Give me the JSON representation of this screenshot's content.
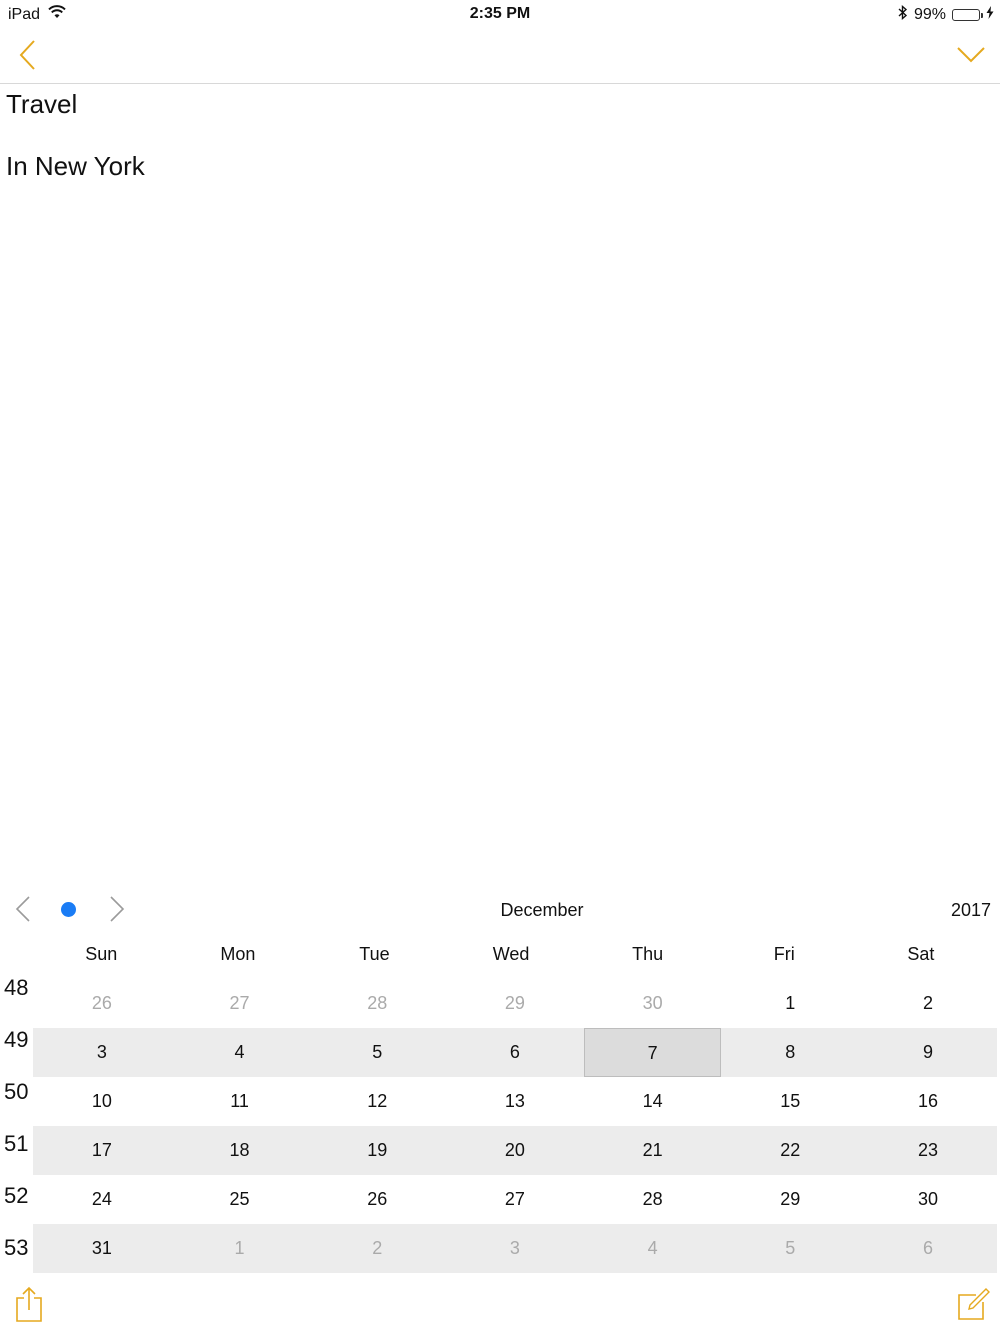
{
  "status_bar": {
    "device": "iPad",
    "time": "2:35 PM",
    "battery_percent": "99%",
    "battery_level": 0.99,
    "battery_color": "#4cd964"
  },
  "colors": {
    "accent": "#e5a91f",
    "today_dot": "#1a7cf5",
    "muted_text": "#aaaaaa"
  },
  "nav": {
    "back_icon": "chevron-left-icon",
    "done_icon": "chevron-down-icon"
  },
  "note": {
    "title": "Travel",
    "body": "In New York"
  },
  "calendar": {
    "month": "December",
    "year": "2017",
    "weekdays": [
      "Sun",
      "Mon",
      "Tue",
      "Wed",
      "Thu",
      "Fri",
      "Sat"
    ],
    "week_numbers": [
      "48",
      "49",
      "50",
      "51",
      "52",
      "53"
    ],
    "selected_day": "7",
    "weeks": [
      [
        {
          "d": "26",
          "m": true
        },
        {
          "d": "27",
          "m": true
        },
        {
          "d": "28",
          "m": true
        },
        {
          "d": "29",
          "m": true
        },
        {
          "d": "30",
          "m": true
        },
        {
          "d": "1",
          "m": false
        },
        {
          "d": "2",
          "m": false
        }
      ],
      [
        {
          "d": "3",
          "m": false
        },
        {
          "d": "4",
          "m": false
        },
        {
          "d": "5",
          "m": false
        },
        {
          "d": "6",
          "m": false
        },
        {
          "d": "7",
          "m": false,
          "sel": true
        },
        {
          "d": "8",
          "m": false
        },
        {
          "d": "9",
          "m": false
        }
      ],
      [
        {
          "d": "10",
          "m": false
        },
        {
          "d": "11",
          "m": false
        },
        {
          "d": "12",
          "m": false
        },
        {
          "d": "13",
          "m": false
        },
        {
          "d": "14",
          "m": false
        },
        {
          "d": "15",
          "m": false
        },
        {
          "d": "16",
          "m": false
        }
      ],
      [
        {
          "d": "17",
          "m": false
        },
        {
          "d": "18",
          "m": false
        },
        {
          "d": "19",
          "m": false
        },
        {
          "d": "20",
          "m": false
        },
        {
          "d": "21",
          "m": false
        },
        {
          "d": "22",
          "m": false
        },
        {
          "d": "23",
          "m": false
        }
      ],
      [
        {
          "d": "24",
          "m": false
        },
        {
          "d": "25",
          "m": false
        },
        {
          "d": "26",
          "m": false
        },
        {
          "d": "27",
          "m": false
        },
        {
          "d": "28",
          "m": false
        },
        {
          "d": "29",
          "m": false
        },
        {
          "d": "30",
          "m": false
        }
      ],
      [
        {
          "d": "31",
          "m": false
        },
        {
          "d": "1",
          "m": true
        },
        {
          "d": "2",
          "m": true
        },
        {
          "d": "3",
          "m": true
        },
        {
          "d": "4",
          "m": true
        },
        {
          "d": "5",
          "m": true
        },
        {
          "d": "6",
          "m": true
        }
      ]
    ]
  },
  "toolbar": {
    "share_icon": "share-icon",
    "compose_icon": "compose-icon"
  }
}
